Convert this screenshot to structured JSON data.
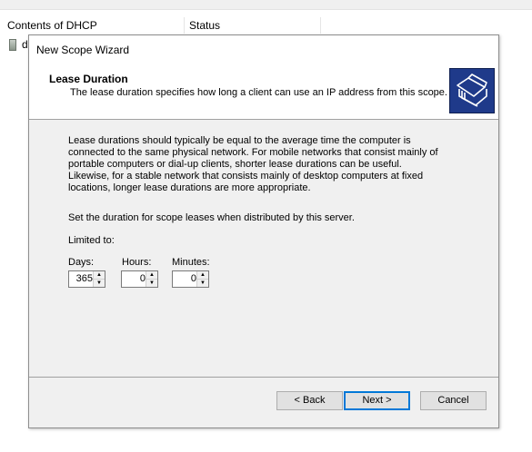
{
  "background": {
    "columns": {
      "contents": "Contents of DHCP",
      "status": "Status"
    },
    "row_text": "d"
  },
  "wizard": {
    "title": "New Scope Wizard",
    "header_title": "Lease Duration",
    "header_subtitle": "The lease duration specifies how long a client can use an IP address from this scope.",
    "icon": "folders-icon",
    "paragraph": [
      "Lease durations should typically be equal to the average time the computer is",
      "connected to the same physical network. For mobile networks that consist mainly of",
      "portable computers or dial-up clients, shorter lease durations can be useful.",
      "Likewise, for a stable network that consists mainly of desktop computers at fixed",
      "locations, longer lease durations are more appropriate."
    ],
    "set_duration": "Set the duration for scope leases when distributed by this server.",
    "limited_to": "Limited to:",
    "fields": {
      "days": {
        "label": "Days:",
        "value": "365"
      },
      "hours": {
        "label": "Hours:",
        "value": "0"
      },
      "minutes": {
        "label": "Minutes:",
        "value": "0"
      }
    },
    "buttons": {
      "back": "< Back",
      "next": "Next >",
      "cancel": "Cancel"
    },
    "accent_color": "#0078d7"
  }
}
